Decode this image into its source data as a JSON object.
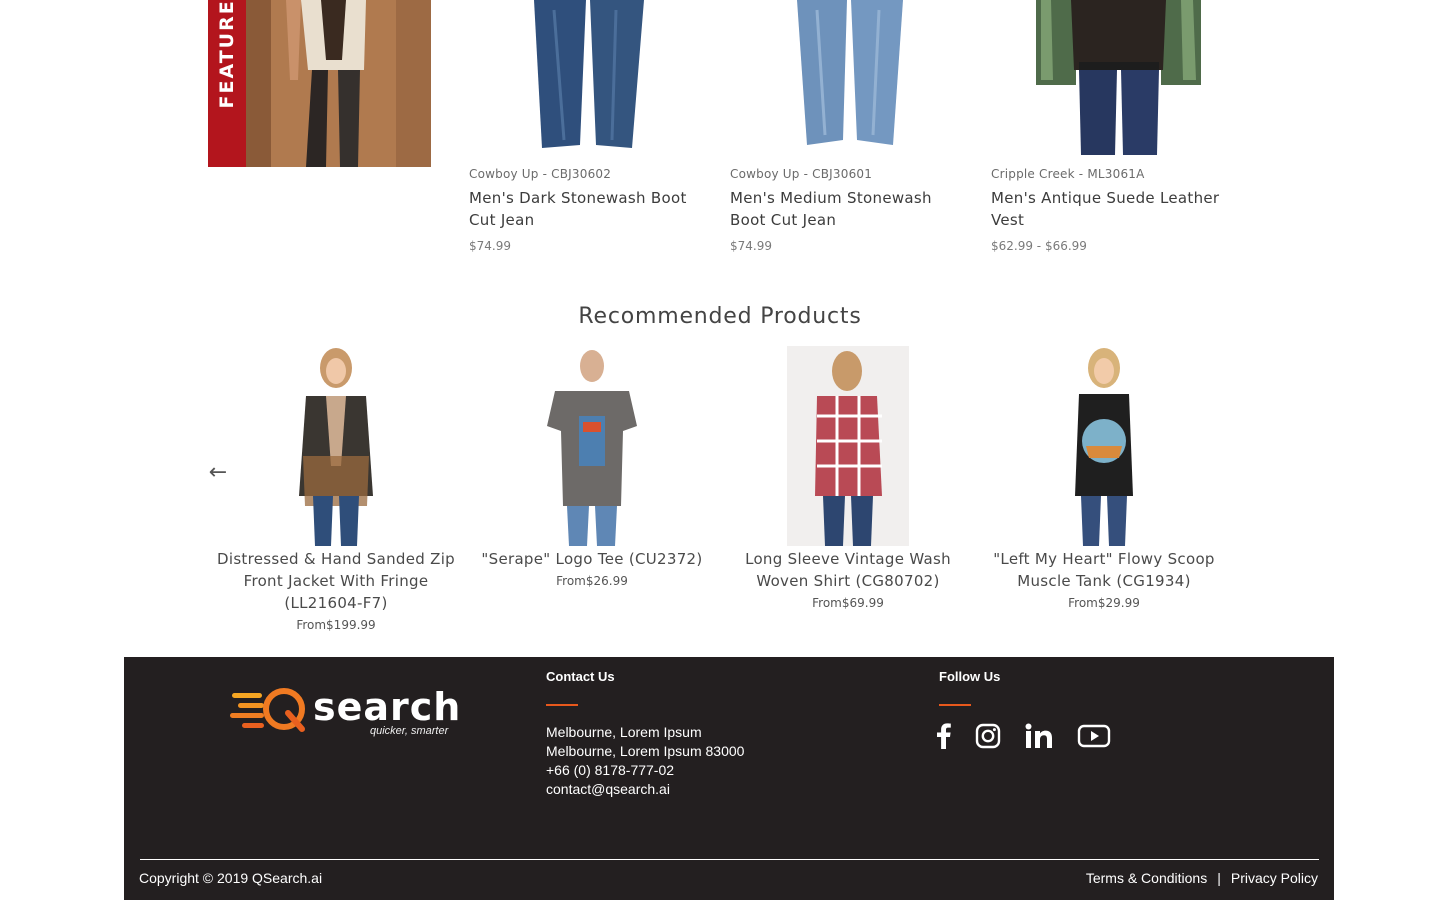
{
  "featured": {
    "banner_text": "FEATURED"
  },
  "top_products": [
    {
      "meta": "Cowboy Up - CBJ30602",
      "name": "Men's Dark Stonewash Boot Cut Jean",
      "price": "$74.99"
    },
    {
      "meta": "Cowboy Up - CBJ30601",
      "name": "Men's Medium Stonewash Boot Cut Jean",
      "price": "$74.99"
    },
    {
      "meta": "Cripple Creek - ML3061A",
      "name": "Men's Antique Suede Leather Vest",
      "price": "$62.99 - $66.99"
    }
  ],
  "recommended": {
    "title": "Recommended Products",
    "prev_arrow": "←",
    "items": [
      {
        "name": "Distressed & Hand Sanded Zip Front Jacket With Fringe (LL21604-F7)",
        "price": "From$199.99"
      },
      {
        "name": "\"Serape\" Logo Tee (CU2372)",
        "price": "From$26.99"
      },
      {
        "name": "Long Sleeve Vintage Wash Woven Shirt (CG80702)",
        "price": "From$69.99"
      },
      {
        "name": "\"Left My Heart\" Flowy Scoop Muscle Tank (CG1934)",
        "price": "From$29.99"
      }
    ]
  },
  "footer": {
    "logo_text": "search",
    "logo_tagline": "quicker, smarter",
    "contact": {
      "heading": "Contact Us",
      "lines": [
        "Melbourne, Lorem Ipsum",
        "Melbourne, Lorem Ipsum 83000",
        "+66 (0) 8178-777-02",
        "contact@qsearch.ai"
      ]
    },
    "follow": {
      "heading": "Follow Us",
      "icons": [
        "facebook-icon",
        "instagram-icon",
        "linkedin-icon",
        "youtube-icon"
      ]
    },
    "copyright": "Copyright © 2019 QSearch.ai",
    "terms": "Terms & Conditions",
    "separator": "|",
    "privacy": "Privacy Policy"
  },
  "colors": {
    "featured_red": "#b3151d",
    "footer_bg": "#231f20",
    "accent_orange": "#e8581c"
  }
}
